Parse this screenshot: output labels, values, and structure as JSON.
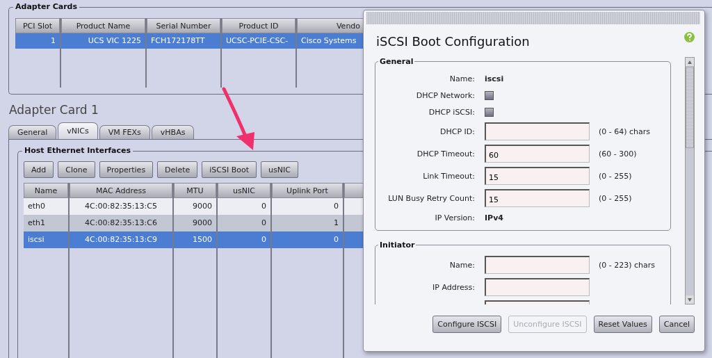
{
  "adapter_cards": {
    "title": "Adapter Cards",
    "columns": [
      "PCI Slot",
      "Product Name",
      "Serial Number",
      "Product ID",
      "Vendo"
    ],
    "rows": [
      {
        "cells": [
          "1",
          "UCS VIC 1225",
          "FCH172178TT",
          "UCSC-PCIE-CSC-",
          "Cisco Systems"
        ],
        "selected": true
      }
    ]
  },
  "adapter_card_heading": "Adapter Card 1",
  "tabs": [
    {
      "label": "General",
      "selected": false
    },
    {
      "label": "vNICs",
      "selected": true
    },
    {
      "label": "VM FEXs",
      "selected": false
    },
    {
      "label": "vHBAs",
      "selected": false
    }
  ],
  "host_ethernet_interfaces": {
    "title": "Host Ethernet Interfaces",
    "buttons": [
      "Add",
      "Clone",
      "Properties",
      "Delete",
      "iSCSI Boot",
      "usNIC"
    ],
    "columns": [
      "Name",
      "MAC Address",
      "MTU",
      "usNIC",
      "Uplink Port"
    ],
    "rows": [
      {
        "cells": [
          "eth0",
          "4C:00:82:35:13:C5",
          "9000",
          "0",
          "0"
        ],
        "selected": false
      },
      {
        "cells": [
          "eth1",
          "4C:00:82:35:13:C6",
          "9000",
          "0",
          "1"
        ],
        "selected": false
      },
      {
        "cells": [
          "iscsi",
          "4C:00:82:35:13:C9",
          "1500",
          "0",
          "0"
        ],
        "selected": true
      }
    ]
  },
  "dialog": {
    "title": "iSCSI Boot Configuration",
    "general": {
      "title": "General",
      "rows": [
        {
          "kind": "text",
          "label": "Name:",
          "value": "iscsi"
        },
        {
          "kind": "checkbox",
          "label": "DHCP Network:",
          "checked": false
        },
        {
          "kind": "checkbox",
          "label": "DHCP iSCSI:",
          "checked": false
        },
        {
          "kind": "input",
          "label": "DHCP ID:",
          "hint": "(0 - 64) chars"
        },
        {
          "kind": "input",
          "label": "DHCP Timeout:",
          "value": "60",
          "hint": "(60 - 300)"
        },
        {
          "kind": "input",
          "label": "Link Timeout:",
          "value": "15",
          "hint": "(0 - 255)"
        },
        {
          "kind": "input",
          "label": "LUN Busy Retry Count:",
          "value": "15",
          "hint": "(0 - 255)"
        },
        {
          "kind": "text",
          "label": "IP Version:",
          "value": "IPv4"
        }
      ]
    },
    "initiator": {
      "title": "Initiator",
      "rows": [
        {
          "kind": "input",
          "label": "Name:",
          "hint": "(0 - 223) chars"
        },
        {
          "kind": "input",
          "label": "IP Address:"
        },
        {
          "kind": "input"
        }
      ]
    },
    "buttons": [
      {
        "label": "Configure ISCSI",
        "disabled": false
      },
      {
        "label": "Unconfigure ISCSI",
        "disabled": true
      },
      {
        "label": "Reset Values",
        "disabled": false
      },
      {
        "label": "Cancel",
        "disabled": false
      }
    ]
  }
}
